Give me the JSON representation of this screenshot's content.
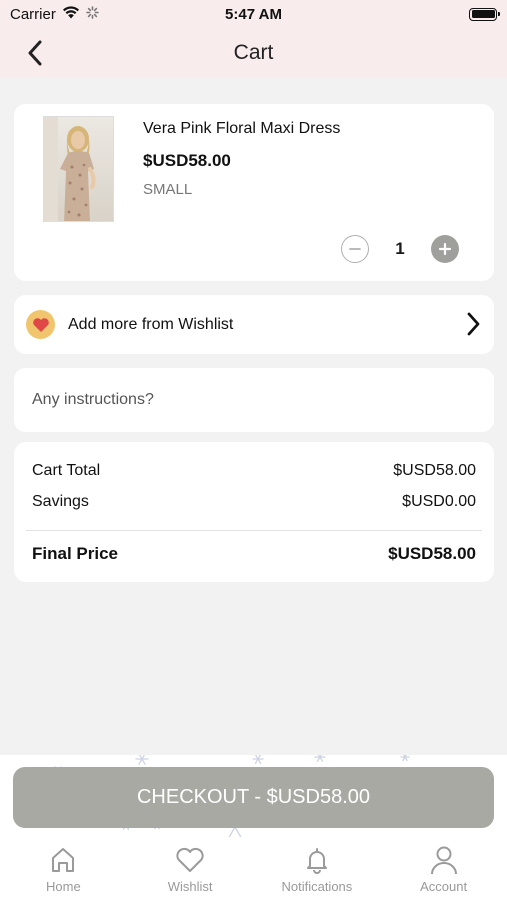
{
  "status_bar": {
    "carrier": "Carrier",
    "time": "5:47 AM"
  },
  "header": {
    "title": "Cart"
  },
  "cart_item": {
    "name": "Vera Pink Floral Maxi Dress",
    "price": "$USD58.00",
    "size": "SMALL",
    "quantity": "1"
  },
  "wishlist_row": {
    "label": "Add more from Wishlist"
  },
  "instructions": {
    "placeholder": "Any instructions?"
  },
  "summary": {
    "cart_total_label": "Cart Total",
    "cart_total_value": "$USD58.00",
    "savings_label": "Savings",
    "savings_value": "$USD0.00",
    "final_label": "Final Price",
    "final_value": "$USD58.00"
  },
  "checkout": {
    "label": "CHECKOUT - $USD58.00"
  },
  "tab_bar": {
    "tabs": [
      {
        "label": "Home",
        "icon": "home-icon"
      },
      {
        "label": "Wishlist",
        "icon": "heart-icon"
      },
      {
        "label": "Notifications",
        "icon": "bell-icon"
      },
      {
        "label": "Account",
        "icon": "user-icon"
      }
    ]
  },
  "colors": {
    "header_bg": "#f8ecec",
    "page_bg": "#f2f2f2",
    "checkout_bg": "#a9a9a3",
    "wishlist_badge": "#f1c56e",
    "heart": "#e04848",
    "tab_inactive": "#9a9a9a"
  }
}
